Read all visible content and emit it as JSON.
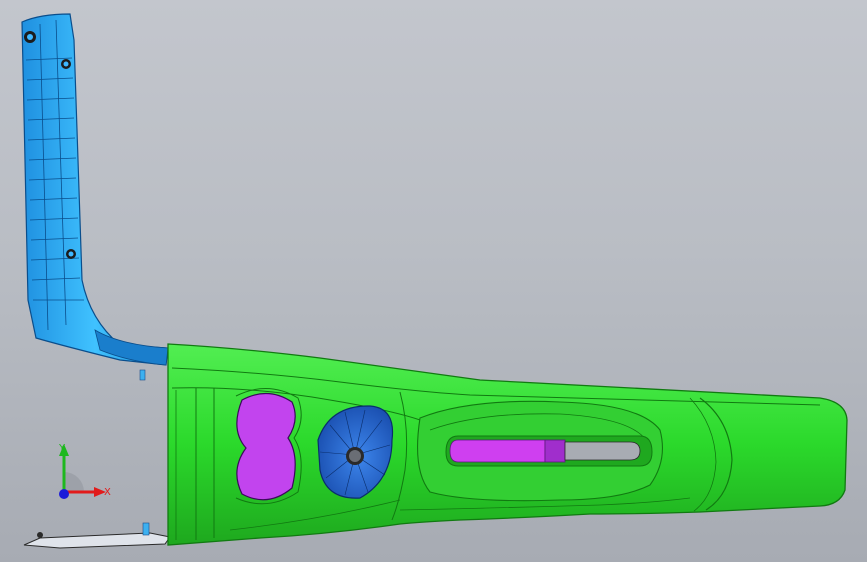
{
  "view": {
    "background_top": "#c3c6cd",
    "background_bottom": "#a7abb3"
  },
  "part_colors": {
    "console_body": "#2bd92b",
    "console_edge": "#117a11",
    "side_panel": "#23a8f5",
    "side_panel_edge": "#0a4e8c",
    "cupholder": "#c244ee",
    "cup_bin": "#2a6fd8",
    "shifter_slot": "#cf3ff0"
  },
  "triad": {
    "x_label": "X",
    "y_label": "Y",
    "x_color": "#e21b1b",
    "y_color": "#1eb81e",
    "origin_color": "#1b1bd8"
  }
}
